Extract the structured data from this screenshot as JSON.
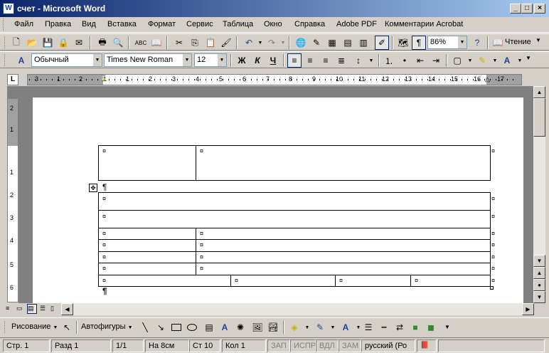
{
  "window": {
    "title": "счет - Microsoft Word",
    "app_icon": "W"
  },
  "menu": [
    "Файл",
    "Правка",
    "Вид",
    "Вставка",
    "Формат",
    "Сервис",
    "Таблица",
    "Окно",
    "Справка",
    "Adobe PDF",
    "Комментарии Acrobat"
  ],
  "toolbar": {
    "zoom": "86%",
    "read_label": "Чтение"
  },
  "format": {
    "style": "Обычный",
    "font": "Times New Roman",
    "size": "12",
    "bold": "Ж",
    "italic": "К",
    "underline": "Ч"
  },
  "ruler": {
    "h_marks": [
      "3",
      "1",
      "2",
      "1",
      "1",
      "2",
      "3",
      "4",
      "5",
      "6",
      "7",
      "8",
      "9",
      "10",
      "11",
      "12",
      "13",
      "14",
      "15",
      "16",
      "17"
    ],
    "v_marks": [
      "2",
      "1",
      "1",
      "2",
      "3",
      "4",
      "5",
      "6"
    ]
  },
  "document": {
    "cell_mark": "¤",
    "para_mark": "¶"
  },
  "drawing": {
    "draw_label": "Рисование",
    "autoshapes_label": "Автофигуры"
  },
  "status": {
    "page": "Стр. 1",
    "section": "Разд 1",
    "pages": "1/1",
    "at": "На 8см",
    "line": "Ст 10",
    "col": "Кол 1",
    "rec": "ЗАП",
    "trk": "ИСПР",
    "ext": "ВДЛ",
    "ovr": "ЗАМ",
    "lang": "русский (Ро"
  }
}
